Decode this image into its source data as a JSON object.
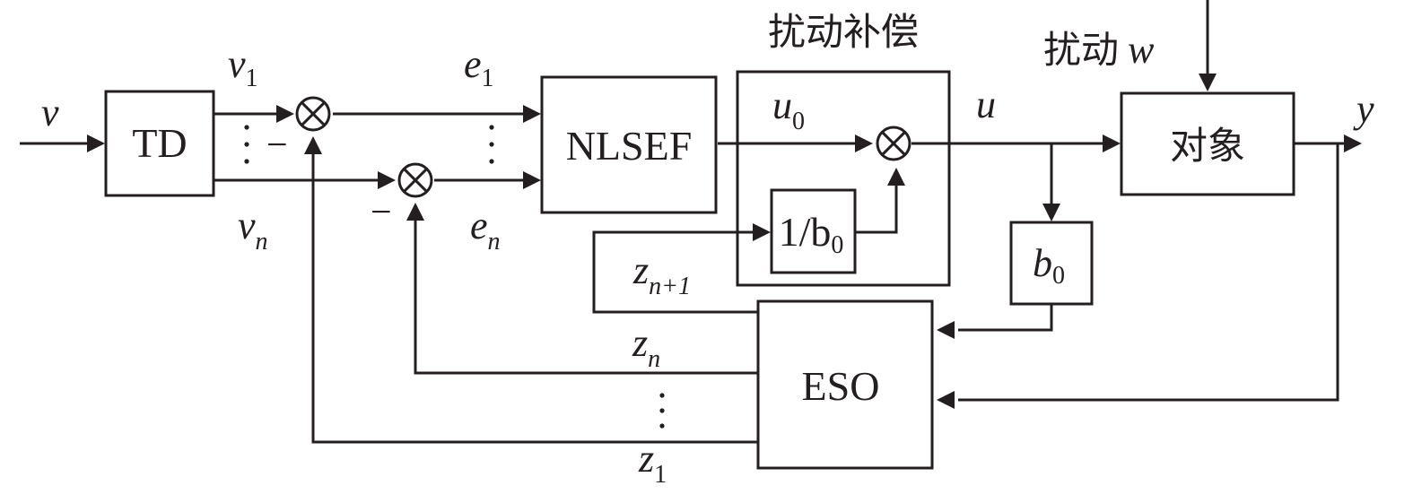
{
  "blocks": {
    "td": "TD",
    "nlsef": "NLSEF",
    "eso": "ESO",
    "plant": "对象",
    "inverse_gain": "1/b",
    "inverse_gain_sub": "0",
    "gain": "b",
    "gain_sub": "0"
  },
  "titles": {
    "compensation": "扰动补偿",
    "disturbance": "扰动",
    "disturbance_symbol": "w"
  },
  "signals": {
    "input": "v",
    "output": "y",
    "control": "u",
    "u0": "u",
    "u0_sub": "0",
    "v1": "v",
    "v1_sub": "1",
    "vn": "v",
    "vn_sub": "n",
    "e1": "e",
    "e1_sub": "1",
    "en": "e",
    "en_sub": "n",
    "z1": "z",
    "z1_sub": "1",
    "zn": "z",
    "zn_sub": "n",
    "zn1": "z",
    "zn1_sub": "n+1"
  },
  "signs": {
    "minus": "−"
  }
}
